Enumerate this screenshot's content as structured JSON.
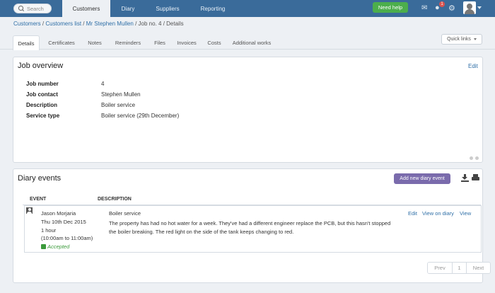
{
  "topnav": {
    "search_label": "Search",
    "tabs": [
      {
        "label": "Customers",
        "active": true
      },
      {
        "label": "Diary",
        "active": false
      },
      {
        "label": "Suppliers",
        "active": false
      },
      {
        "label": "Reporting",
        "active": false
      }
    ],
    "help_label": "Need help",
    "notification_count": "1",
    "icons": [
      "chat-icon",
      "globe-icon",
      "gear-icon",
      "avatar",
      "chevron-down-icon"
    ],
    "colors": {
      "nav_bg": "#3a6b9a",
      "help_bg": "#4cae4c",
      "badge_bg": "#d9534f"
    }
  },
  "breadcrumb": {
    "items": [
      "Customers",
      "Customers list",
      "Mr Stephen Mullen",
      "Job no. 4",
      "Details"
    ],
    "separator": " / "
  },
  "subtabs": {
    "items": [
      "Details",
      "Certificates",
      "Notes",
      "Reminders",
      "Files",
      "Invoices",
      "Costs",
      "Additional works"
    ],
    "active": "Details",
    "quick_links_label": "Quick links"
  },
  "job_overview": {
    "title": "Job overview",
    "edit_label": "Edit",
    "fields": [
      {
        "label": "Job number",
        "value": "4"
      },
      {
        "label": "Job contact",
        "value": "Stephen Mullen"
      },
      {
        "label": "Description",
        "value": "Boiler service"
      },
      {
        "label": "Service type",
        "value": "Boiler service (29th December)"
      }
    ]
  },
  "diary_events": {
    "title": "Diary events",
    "add_button_label": "Add new diary event",
    "columns": [
      "EVENT",
      "DESCRIPTION"
    ],
    "events": [
      {
        "engineer": "Jason Morjaria",
        "date": "Thu 10th Dec 2015",
        "duration": "1 hour",
        "time_range": "(10:00am to 11:00am)",
        "status": "Accepted",
        "description_title": "Boiler service",
        "description_body": "The property has had no hot water for a week. They've had a different engineer replace the PCB, but this hasn't stopped the boiler breaking. The red light on the side of the tank keeps changing to red.",
        "actions": [
          "Edit",
          "View on diary",
          "View"
        ]
      }
    ],
    "pagination": {
      "prev": "Prev",
      "page": "1",
      "next": "Next"
    },
    "colors": {
      "add_button_bg": "#7a6bac",
      "accepted": "#3a9a3a"
    }
  }
}
